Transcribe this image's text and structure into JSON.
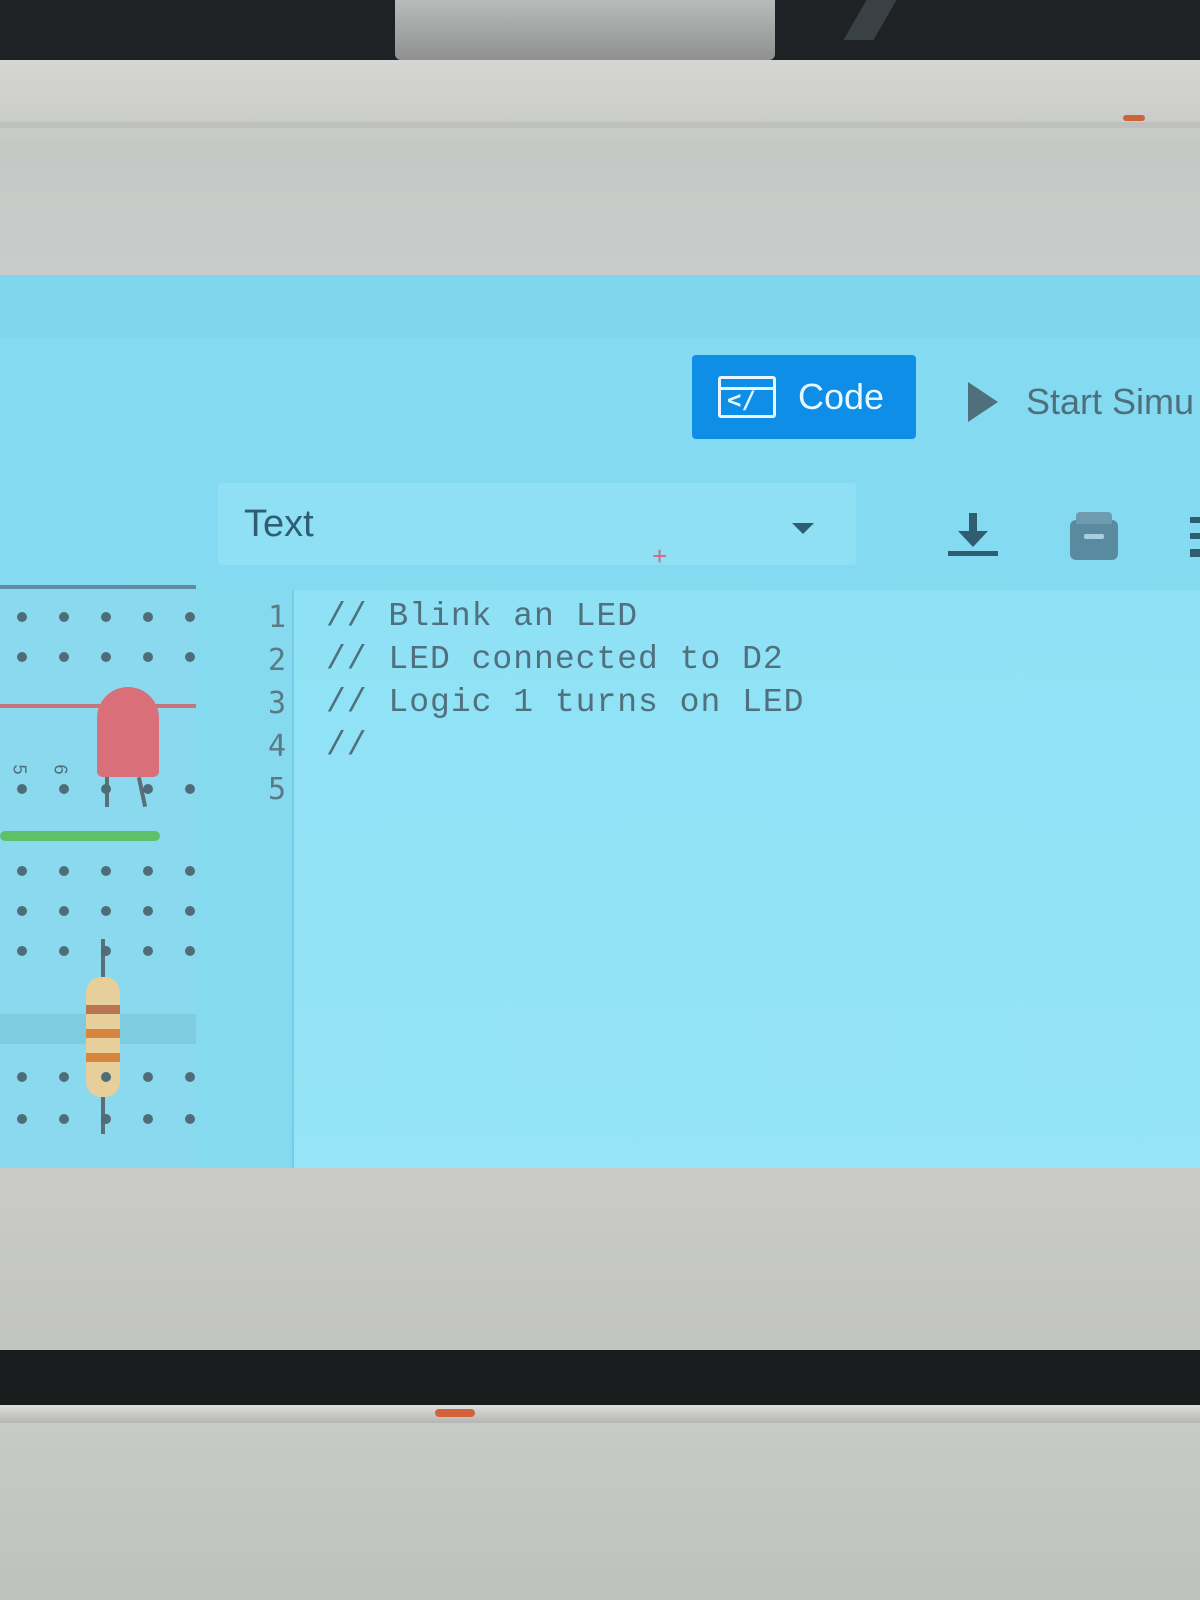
{
  "toolbar": {
    "code_button_label": "Code",
    "code_icon_glyph": "</",
    "start_sim_label": "Start Simu"
  },
  "editor": {
    "mode_select_value": "Text",
    "line_numbers": [
      "1",
      "2",
      "3",
      "4",
      "5"
    ],
    "code_lines": [
      "// Blink an LED",
      "// LED connected to D2",
      "// Logic 1 turns on LED",
      "//",
      ""
    ]
  },
  "breadboard": {
    "column_labels": [
      "5",
      "6"
    ]
  },
  "icons": {
    "code_button": "code-window-icon",
    "start": "play-icon",
    "download": "download-icon",
    "upload": "upload-box-icon",
    "dropdown": "caret-down-icon"
  },
  "colors": {
    "accent": "#0e8ee6",
    "screen_bg": "#84dbf1",
    "led": "#d86f79"
  }
}
